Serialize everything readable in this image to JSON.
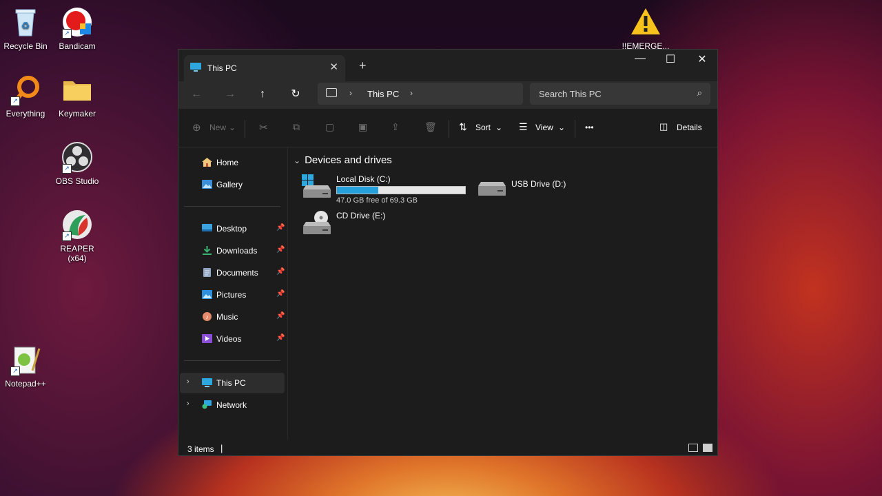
{
  "desktop": {
    "icons": [
      {
        "label": "Recycle Bin"
      },
      {
        "label": "Bandicam"
      },
      {
        "label": "Everything"
      },
      {
        "label": "Keymaker"
      },
      {
        "label": "OBS Studio"
      },
      {
        "label": "REAPER (x64)"
      },
      {
        "label": "Notepad++"
      },
      {
        "label": "!!EMERGE..."
      }
    ]
  },
  "window": {
    "tab_title": "This PC",
    "new_tab_glyph": "+",
    "controls": {
      "minimize": "—",
      "maximize": "☐",
      "close": "✕"
    }
  },
  "navbar": {
    "back": "←",
    "forward": "→",
    "up": "↑",
    "refresh": "↻",
    "breadcrumb": [
      "This PC"
    ],
    "search_placeholder": "Search This PC"
  },
  "commandbar": {
    "new_label": "New",
    "sort_label": "Sort",
    "view_label": "View",
    "more_label": "•••",
    "details_label": "Details"
  },
  "sidebar": {
    "items": [
      {
        "label": "Home",
        "icon": "home-icon"
      },
      {
        "label": "Gallery",
        "icon": "gallery-icon"
      },
      {
        "label": "Desktop",
        "icon": "desktop-folder-icon",
        "pinned": true
      },
      {
        "label": "Downloads",
        "icon": "downloads-icon",
        "pinned": true
      },
      {
        "label": "Documents",
        "icon": "documents-icon",
        "pinned": true
      },
      {
        "label": "Pictures",
        "icon": "pictures-icon",
        "pinned": true
      },
      {
        "label": "Music",
        "icon": "music-icon",
        "pinned": true
      },
      {
        "label": "Videos",
        "icon": "videos-icon",
        "pinned": true
      },
      {
        "label": "This PC",
        "icon": "this-pc-icon",
        "active": true
      },
      {
        "label": "Network",
        "icon": "network-icon"
      }
    ]
  },
  "content": {
    "group_title": "Devices and drives",
    "drives": [
      {
        "name": "Local Disk (C:)",
        "free_text": "47.0 GB free of 69.3 GB",
        "used_fraction": 0.322
      },
      {
        "name": "USB Drive (D:)"
      },
      {
        "name": "CD Drive (E:)"
      }
    ]
  },
  "statusbar": {
    "items_count": "3 items",
    "caret": "|"
  },
  "colors": {
    "accent": "#26a0da",
    "window_bg": "#1c1c1c",
    "toolbar_bg": "#2b2b2b"
  }
}
